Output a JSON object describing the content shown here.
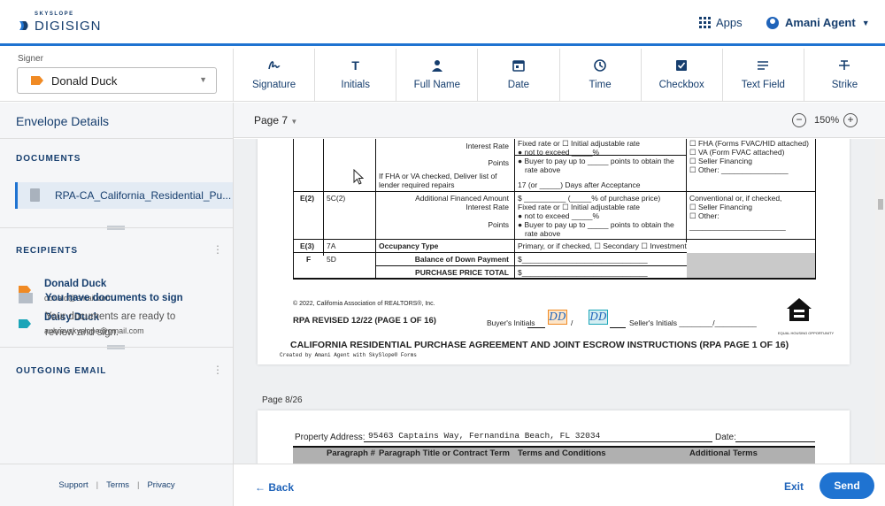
{
  "header": {
    "logo_small": "SKYSLOPE",
    "logo_main": "DIGISIGN",
    "apps_label": "Apps",
    "user_name": "Amani Agent"
  },
  "signer": {
    "label": "Signer",
    "selected": "Donald Duck",
    "color": "#f08a24"
  },
  "tools": [
    {
      "label": "Signature",
      "icon": "signature-icon"
    },
    {
      "label": "Initials",
      "icon": "initials-icon"
    },
    {
      "label": "Full Name",
      "icon": "person-icon"
    },
    {
      "label": "Date",
      "icon": "calendar-icon"
    },
    {
      "label": "Time",
      "icon": "clock-icon"
    },
    {
      "label": "Checkbox",
      "icon": "checkbox-icon"
    },
    {
      "label": "Text Field",
      "icon": "text-field-icon"
    },
    {
      "label": "Strike",
      "icon": "strike-icon"
    }
  ],
  "sidebar": {
    "title": "Envelope Details",
    "documents_title": "DOCUMENTS",
    "document_name": "RPA-CA_California_Residential_Pu...",
    "recipients_title": "RECIPIENTS",
    "recipients": [
      {
        "name": "Donald Duck",
        "email": "donald@email.com",
        "color": "#f08a24"
      },
      {
        "name": "Daisy Duck",
        "email": "aubreyskyslope@gmail.com",
        "color": "#1aa5b8"
      }
    ],
    "outgoing_title": "OUTGOING EMAIL",
    "email_heading": "You have documents to sign",
    "email_body": "Your documents are ready to review and sign.",
    "footer": {
      "support": "Support",
      "sep": "|",
      "terms": "Terms",
      "privacy": "Privacy"
    }
  },
  "viewer": {
    "page_selector": "Page 7",
    "zoom": "150%",
    "zoom_minus": "−",
    "zoom_plus": "+",
    "page_label_2": "Page 8/26"
  },
  "doc": {
    "r0": {
      "a": "Interest Rate",
      "b": "Fixed rate or ☐ Initial adjustable rate",
      "c": "● not to exceed _____%",
      "d": "Points",
      "e": "● Buyer to pay up to _____ points to obtain the",
      "f": "rate above",
      "g": "If FHA or VA checked, Deliver list of",
      "h": "lender required repairs",
      "i": "17 (or _____) Days after Acceptance",
      "j": "☐ FHA (Forms FVAC/HID attached)",
      "k": "☐ VA (Form FVAC attached)",
      "l": "☐ Seller Financing",
      "m": "☐ Other: ________________"
    },
    "r1": {
      "id": "E(2)",
      "para": "5C(2)",
      "a": "Additional Financed Amount",
      "b": "Interest Rate",
      "c": "Points",
      "d": "$ __________ (_____% of purchase price)",
      "e": "Fixed rate or ☐ Initial adjustable rate",
      "f": "● not to exceed _____%",
      "g": "● Buyer to pay up to _____ points to obtain the",
      "h": "rate above",
      "i": "Conventional or, if checked,",
      "j": "☐ Seller Financing",
      "k": "☐ Other:",
      "l": "_______________________"
    },
    "r2": {
      "id": "E(3)",
      "para": "7A",
      "a": "Occupancy Type",
      "b": "Primary, or if checked, ☐ Secondary ☐ Investment"
    },
    "r3": {
      "id": "F",
      "para": "5D",
      "a": "Balance of Down Payment",
      "b": "$______________________________"
    },
    "r4": {
      "a": "PURCHASE PRICE TOTAL",
      "b": "$______________________________"
    },
    "copyright": "© 2022, California Association of REALTORS®, Inc.",
    "revised": "RPA REVISED 12/22 (PAGE 1 OF 16)",
    "buyers_initials": "Buyer's Initials",
    "initials_text": "DD",
    "sellers_initials": "Seller's Initials ________/__________",
    "eh": "EQUAL HOUSING OPPORTUNITY",
    "footer_title": "CALIFORNIA RESIDENTIAL PURCHASE AGREEMENT AND JOINT ESCROW INSTRUCTIONS (RPA PAGE 1 OF 16)",
    "created_by": "Created by Amani Agent with SkySlope® Forms",
    "p2_property_label": "Property Address:",
    "p2_property": "95463 Captains Way, Fernandina Beach, FL 32034",
    "p2_date": "Date:",
    "p2_h1": "Paragraph #",
    "p2_h2": "Paragraph Title or Contract Term",
    "p2_h3": "Terms and Conditions",
    "p2_h4": "Additional Terms"
  },
  "bottom": {
    "back": "Back",
    "exit": "Exit",
    "send": "Send"
  },
  "colors": {
    "accent": "#1f73d1",
    "navy": "#163e6e"
  }
}
